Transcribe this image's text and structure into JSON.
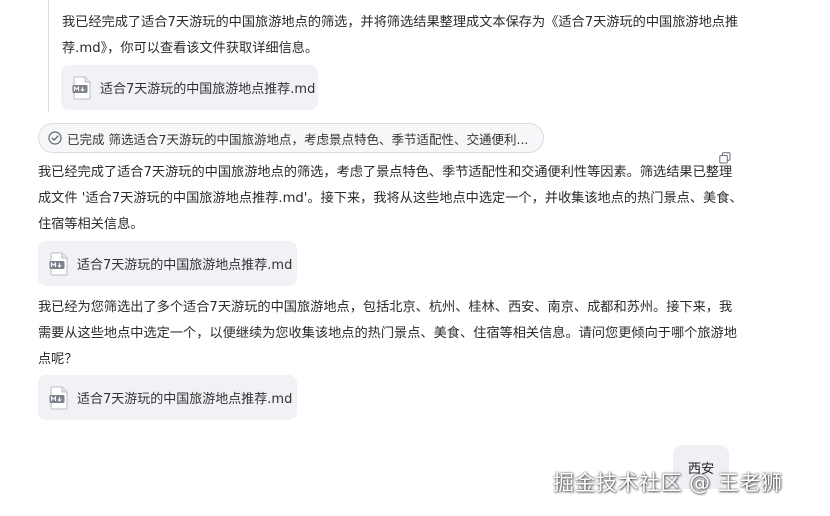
{
  "messages": {
    "quoted": {
      "text": "我已经完成了适合7天游玩的中国旅游地点的筛选，并将筛选结果整理成文本保存为《适合7天游玩的中国旅游地点推荐.md》，你可以查看该文件获取详细信息。",
      "file_name": "适合7天游玩的中国旅游地点推荐.md"
    },
    "status": {
      "label": "已完成",
      "text": "筛选适合7天游玩的中国旅游地点，考虑景点特色、季节适配性、交通便利..."
    },
    "assistant_1": {
      "text": "我已经完成了适合7天游玩的中国旅游地点的筛选，考虑了景点特色、季节适配性和交通便利性等因素。筛选结果已整理成文件 '适合7天游玩的中国旅游地点推荐.md'。接下来，我将从这些地点中选定一个，并收集该地点的热门景点、美食、住宿等相关信息。",
      "file_name": "适合7天游玩的中国旅游地点推荐.md"
    },
    "assistant_2": {
      "text": "我已经为您筛选出了多个适合7天游玩的中国旅游地点，包括北京、杭州、桂林、西安、南京、成都和苏州。接下来，我需要从这些地点中选定一个，以便继续为您收集该地点的热门景点、美食、住宿等相关信息。请问您更倾向于哪个旅游地点呢？",
      "file_name": "适合7天游玩的中国旅游地点推荐.md"
    },
    "user_reply": {
      "text": "西安"
    }
  },
  "icons": {
    "file": "markdown-file-icon",
    "status": "check-circle-icon",
    "copy": "copy-icon"
  },
  "watermark": {
    "text": "掘金技术社区 @ 王老狮"
  },
  "colors": {
    "card_bg": "#f1f2f5",
    "pill_bg": "#f6f7f9",
    "user_bubble_bg": "#eef0f4",
    "text": "#2b2b2b",
    "check": "#5c6370"
  }
}
